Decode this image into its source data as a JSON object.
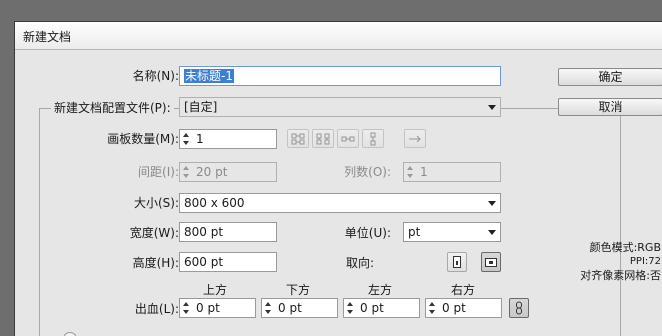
{
  "dialog": {
    "title": "新建文档"
  },
  "name": {
    "label": "名称(N):",
    "value": "未标题-1"
  },
  "profile": {
    "label": "新建文档配置文件(P):",
    "value": "[自定]"
  },
  "artboards": {
    "count_label": "画板数量(M):",
    "count_value": "1",
    "spacing_label": "间距(I):",
    "spacing_value": "20 pt",
    "columns_label": "列数(O):",
    "columns_value": "1",
    "layout_icons": [
      "grid-by-row-icon",
      "grid-by-column-icon",
      "arrange-by-row-icon",
      "arrange-by-column-icon",
      "right-to-left-icon"
    ]
  },
  "size": {
    "label": "大小(S):",
    "value": "800 x 600"
  },
  "width": {
    "label": "宽度(W):",
    "value": "800 pt"
  },
  "units": {
    "label": "单位(U):",
    "value": "pt"
  },
  "height": {
    "label": "高度(H):",
    "value": "600 pt"
  },
  "orientation": {
    "label": "取向:",
    "portrait_icon": "portrait-icon",
    "landscape_icon": "landscape-icon",
    "selected": "landscape"
  },
  "bleed": {
    "label": "出血(L):",
    "top_label": "上方",
    "top_value": "0 pt",
    "bottom_label": "下方",
    "bottom_value": "0 pt",
    "left_label": "左方",
    "left_value": "0 pt",
    "right_label": "右方",
    "right_value": "0 pt"
  },
  "buttons": {
    "ok": "确定",
    "cancel": "取消"
  },
  "info": {
    "color_mode": "颜色模式:RGB",
    "ppi": "PPI:72",
    "pixel_grid": "对齐像素网格:否"
  }
}
